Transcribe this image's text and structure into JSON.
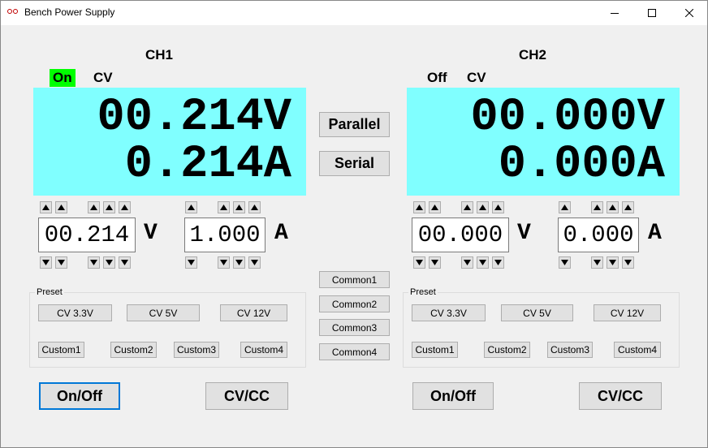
{
  "window": {
    "title": "Bench Power Supply",
    "icon": "power-supply-icon"
  },
  "ch1": {
    "title": "CH1",
    "output_state": "On",
    "mode": "CV",
    "voltage_display": "00.214V",
    "current_display": "0.214A",
    "voltage_set": "00.214",
    "voltage_unit": "V",
    "current_set": "1.000",
    "current_unit": "A",
    "on_badge_color": "#00ff00"
  },
  "ch2": {
    "title": "CH2",
    "output_state": "Off",
    "mode": "CV",
    "voltage_display": "00.000V",
    "current_display": "0.000A",
    "voltage_set": "00.000",
    "voltage_unit": "V",
    "current_set": "0.000",
    "current_unit": "A"
  },
  "display_color": "#80ffff",
  "center": {
    "parallel": "Parallel",
    "serial": "Serial",
    "common": [
      "Common1",
      "Common2",
      "Common3",
      "Common4"
    ]
  },
  "preset": {
    "label": "Preset",
    "fixed": [
      "CV 3.3V",
      "CV 5V",
      "CV 12V"
    ],
    "custom": [
      "Custom1",
      "Custom2",
      "Custom3",
      "Custom4"
    ]
  },
  "controls": {
    "onoff": "On/Off",
    "cvcc": "CV/CC"
  }
}
